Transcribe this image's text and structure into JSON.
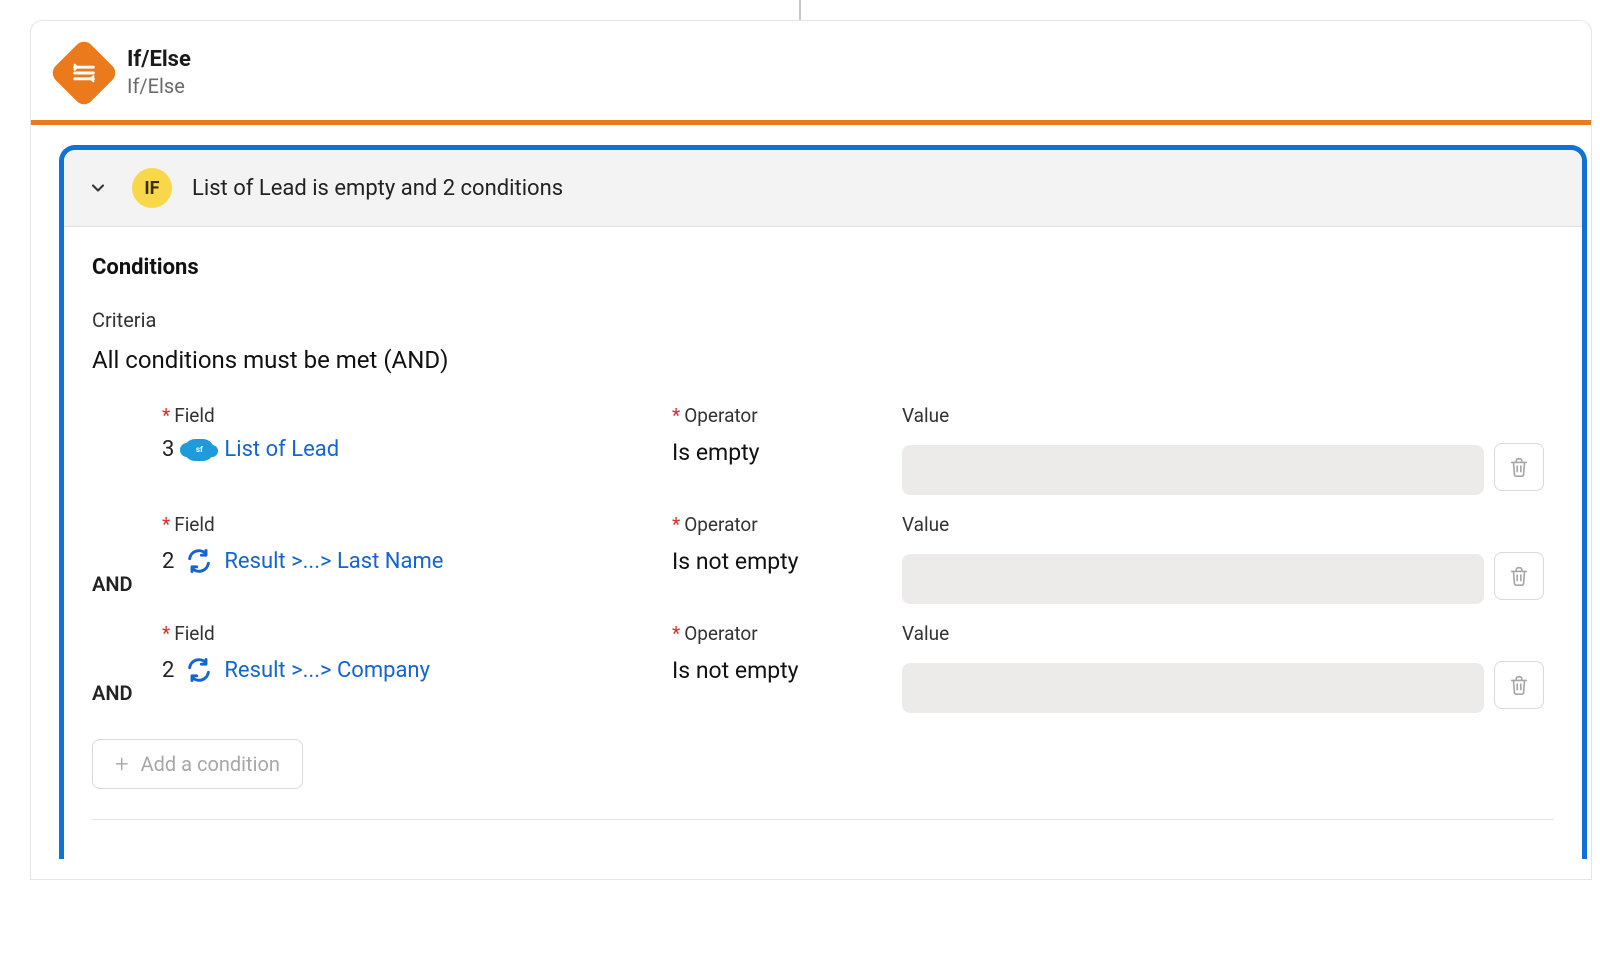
{
  "header": {
    "title": "If/Else",
    "subtitle": "If/Else"
  },
  "summary": {
    "pill": "IF",
    "text": "List of Lead is empty and 2 conditions"
  },
  "panel": {
    "conditions_title": "Conditions",
    "criteria_label": "Criteria",
    "criteria_value": "All conditions must be met (AND)"
  },
  "labels": {
    "field": "Field",
    "operator": "Operator",
    "value": "Value",
    "and": "AND",
    "add_condition": "Add a condition"
  },
  "rows": [
    {
      "and": "",
      "step": "3",
      "icon": "salesforce",
      "field": "List of Lead",
      "operator": "Is empty"
    },
    {
      "and": "AND",
      "step": "2",
      "icon": "cycle",
      "field": "Result >...> Last Name",
      "operator": "Is not empty"
    },
    {
      "and": "AND",
      "step": "2",
      "icon": "cycle",
      "field": "Result >...> Company",
      "operator": "Is not empty"
    }
  ]
}
